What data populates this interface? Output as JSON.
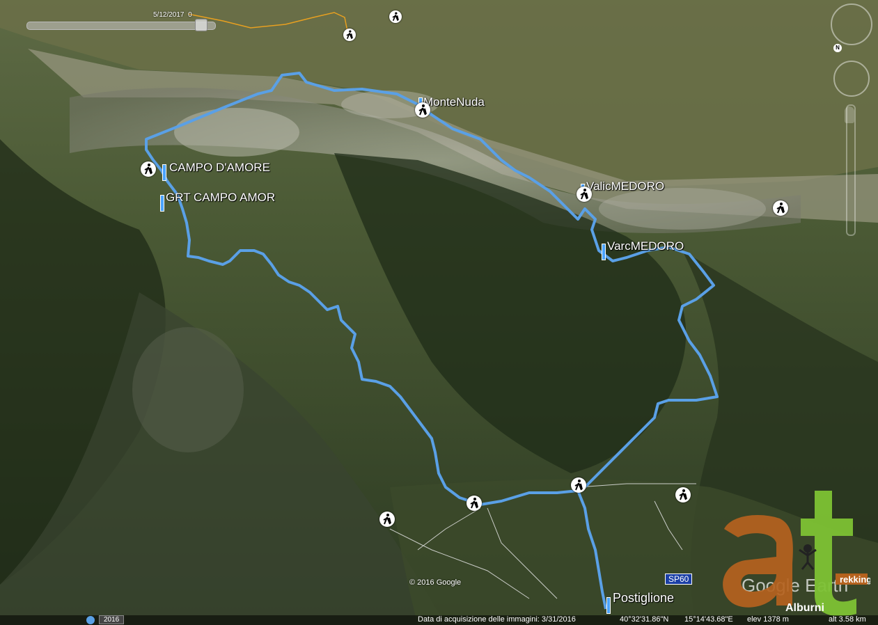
{
  "map": {
    "copyright": "© 2016 Google",
    "year_badge": "2016",
    "time_slider": {
      "date": "5/12/2017",
      "value": "0"
    },
    "road_label": "SP60",
    "status": {
      "acquisition": "Data di acquisizione delle immagini: 3/31/2016",
      "lat": "40°32'31.86\"N",
      "lon": "15°14'43.68\"E",
      "elev": "elev  1378 m",
      "alt": "alt  3.58 km"
    },
    "places": {
      "monte_nuda": "MonteNuda",
      "campo_damore": "CAMPO D'AMORE",
      "grt_campo": "GRT CAMPO AMOR",
      "valic_medoro": "ValicMEDORO",
      "varc_medoro": "VarcMEDORO",
      "postiglione": "Postiglione"
    },
    "compass": "N",
    "watermark": "Google Earth",
    "logo": {
      "letters": "at",
      "word1": "rekking",
      "word2": "Alburni"
    },
    "colors": {
      "track": "#5aa0e6",
      "path": "#e8a020",
      "logo_brown": "#b5621e",
      "logo_green": "#7dc234"
    }
  }
}
